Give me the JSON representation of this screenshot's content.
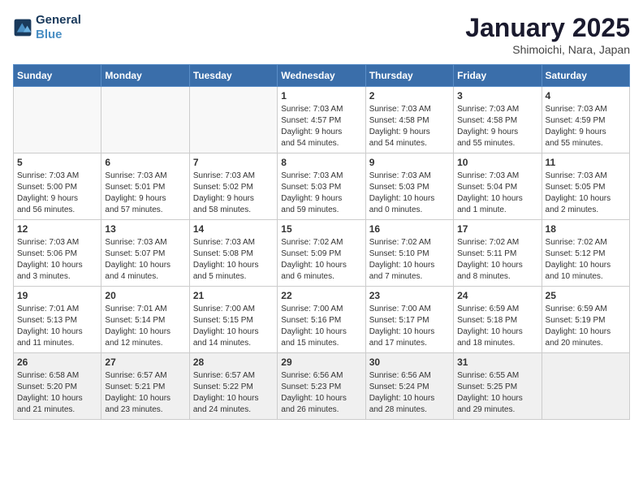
{
  "logo": {
    "line1": "General",
    "line2": "Blue"
  },
  "header": {
    "title": "January 2025",
    "subtitle": "Shimoichi, Nara, Japan"
  },
  "weekdays": [
    "Sunday",
    "Monday",
    "Tuesday",
    "Wednesday",
    "Thursday",
    "Friday",
    "Saturday"
  ],
  "weeks": [
    [
      {
        "day": "",
        "info": ""
      },
      {
        "day": "",
        "info": ""
      },
      {
        "day": "",
        "info": ""
      },
      {
        "day": "1",
        "info": "Sunrise: 7:03 AM\nSunset: 4:57 PM\nDaylight: 9 hours\nand 54 minutes."
      },
      {
        "day": "2",
        "info": "Sunrise: 7:03 AM\nSunset: 4:58 PM\nDaylight: 9 hours\nand 54 minutes."
      },
      {
        "day": "3",
        "info": "Sunrise: 7:03 AM\nSunset: 4:58 PM\nDaylight: 9 hours\nand 55 minutes."
      },
      {
        "day": "4",
        "info": "Sunrise: 7:03 AM\nSunset: 4:59 PM\nDaylight: 9 hours\nand 55 minutes."
      }
    ],
    [
      {
        "day": "5",
        "info": "Sunrise: 7:03 AM\nSunset: 5:00 PM\nDaylight: 9 hours\nand 56 minutes."
      },
      {
        "day": "6",
        "info": "Sunrise: 7:03 AM\nSunset: 5:01 PM\nDaylight: 9 hours\nand 57 minutes."
      },
      {
        "day": "7",
        "info": "Sunrise: 7:03 AM\nSunset: 5:02 PM\nDaylight: 9 hours\nand 58 minutes."
      },
      {
        "day": "8",
        "info": "Sunrise: 7:03 AM\nSunset: 5:03 PM\nDaylight: 9 hours\nand 59 minutes."
      },
      {
        "day": "9",
        "info": "Sunrise: 7:03 AM\nSunset: 5:03 PM\nDaylight: 10 hours\nand 0 minutes."
      },
      {
        "day": "10",
        "info": "Sunrise: 7:03 AM\nSunset: 5:04 PM\nDaylight: 10 hours\nand 1 minute."
      },
      {
        "day": "11",
        "info": "Sunrise: 7:03 AM\nSunset: 5:05 PM\nDaylight: 10 hours\nand 2 minutes."
      }
    ],
    [
      {
        "day": "12",
        "info": "Sunrise: 7:03 AM\nSunset: 5:06 PM\nDaylight: 10 hours\nand 3 minutes."
      },
      {
        "day": "13",
        "info": "Sunrise: 7:03 AM\nSunset: 5:07 PM\nDaylight: 10 hours\nand 4 minutes."
      },
      {
        "day": "14",
        "info": "Sunrise: 7:03 AM\nSunset: 5:08 PM\nDaylight: 10 hours\nand 5 minutes."
      },
      {
        "day": "15",
        "info": "Sunrise: 7:02 AM\nSunset: 5:09 PM\nDaylight: 10 hours\nand 6 minutes."
      },
      {
        "day": "16",
        "info": "Sunrise: 7:02 AM\nSunset: 5:10 PM\nDaylight: 10 hours\nand 7 minutes."
      },
      {
        "day": "17",
        "info": "Sunrise: 7:02 AM\nSunset: 5:11 PM\nDaylight: 10 hours\nand 8 minutes."
      },
      {
        "day": "18",
        "info": "Sunrise: 7:02 AM\nSunset: 5:12 PM\nDaylight: 10 hours\nand 10 minutes."
      }
    ],
    [
      {
        "day": "19",
        "info": "Sunrise: 7:01 AM\nSunset: 5:13 PM\nDaylight: 10 hours\nand 11 minutes."
      },
      {
        "day": "20",
        "info": "Sunrise: 7:01 AM\nSunset: 5:14 PM\nDaylight: 10 hours\nand 12 minutes."
      },
      {
        "day": "21",
        "info": "Sunrise: 7:00 AM\nSunset: 5:15 PM\nDaylight: 10 hours\nand 14 minutes."
      },
      {
        "day": "22",
        "info": "Sunrise: 7:00 AM\nSunset: 5:16 PM\nDaylight: 10 hours\nand 15 minutes."
      },
      {
        "day": "23",
        "info": "Sunrise: 7:00 AM\nSunset: 5:17 PM\nDaylight: 10 hours\nand 17 minutes."
      },
      {
        "day": "24",
        "info": "Sunrise: 6:59 AM\nSunset: 5:18 PM\nDaylight: 10 hours\nand 18 minutes."
      },
      {
        "day": "25",
        "info": "Sunrise: 6:59 AM\nSunset: 5:19 PM\nDaylight: 10 hours\nand 20 minutes."
      }
    ],
    [
      {
        "day": "26",
        "info": "Sunrise: 6:58 AM\nSunset: 5:20 PM\nDaylight: 10 hours\nand 21 minutes."
      },
      {
        "day": "27",
        "info": "Sunrise: 6:57 AM\nSunset: 5:21 PM\nDaylight: 10 hours\nand 23 minutes."
      },
      {
        "day": "28",
        "info": "Sunrise: 6:57 AM\nSunset: 5:22 PM\nDaylight: 10 hours\nand 24 minutes."
      },
      {
        "day": "29",
        "info": "Sunrise: 6:56 AM\nSunset: 5:23 PM\nDaylight: 10 hours\nand 26 minutes."
      },
      {
        "day": "30",
        "info": "Sunrise: 6:56 AM\nSunset: 5:24 PM\nDaylight: 10 hours\nand 28 minutes."
      },
      {
        "day": "31",
        "info": "Sunrise: 6:55 AM\nSunset: 5:25 PM\nDaylight: 10 hours\nand 29 minutes."
      },
      {
        "day": "",
        "info": ""
      }
    ]
  ]
}
